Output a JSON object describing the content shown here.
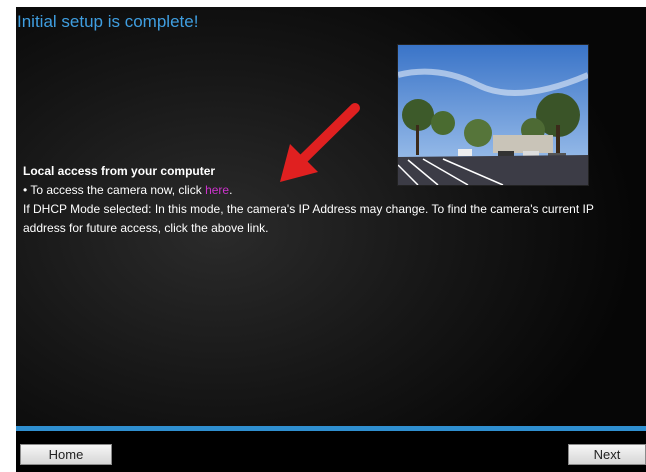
{
  "title": "Initial setup is complete!",
  "local_access": {
    "heading": "Local access from your computer",
    "line_prefix": "• To access the camera now, click ",
    "link_text": "here",
    "line_suffix": ".",
    "dhcp_note": "If DHCP Mode selected: In this mode, the camera's IP Address may change. To find the camera's current IP address for future access, click the above link."
  },
  "buttons": {
    "home": "Home",
    "next": "Next"
  },
  "colors": {
    "title": "#3f9ee0",
    "link": "#cc33cc",
    "accent_bar": "#2f8fd0",
    "arrow": "#e02020"
  },
  "icons": {
    "arrow": "red-arrow-icon",
    "photo": "camera-view-photo"
  }
}
